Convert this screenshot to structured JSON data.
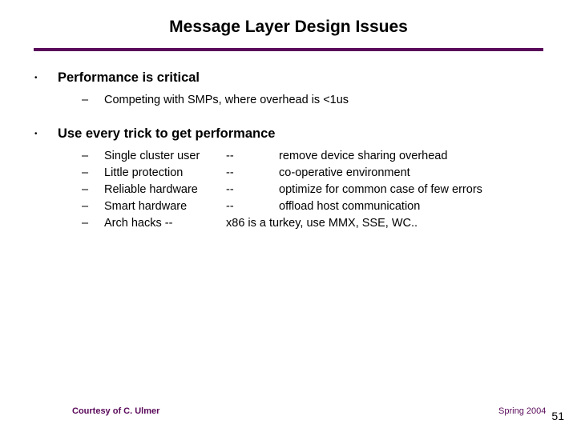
{
  "title": "Message Layer Design Issues",
  "bullets": {
    "b1": {
      "heading": "Performance is critical",
      "sub1": "Competing with SMPs, where overhead is <1us"
    },
    "b2": {
      "heading": "Use every trick to get performance",
      "rows": [
        {
          "left": "Single cluster user",
          "right": "--              remove device sharing overhead"
        },
        {
          "left": "Little protection",
          "right": "--              co-operative environment"
        },
        {
          "left": "Reliable hardware",
          "right": "--              optimize for common case of few errors"
        },
        {
          "left": "Smart hardware",
          "right": "--              offload host communication"
        },
        {
          "left": "Arch hacks --",
          "right": "x86 is a turkey, use MMX, SSE, WC.."
        }
      ]
    }
  },
  "footer": {
    "courtesy": "Courtesy of C. Ulmer",
    "term": "Spring 2004",
    "page": "51"
  }
}
